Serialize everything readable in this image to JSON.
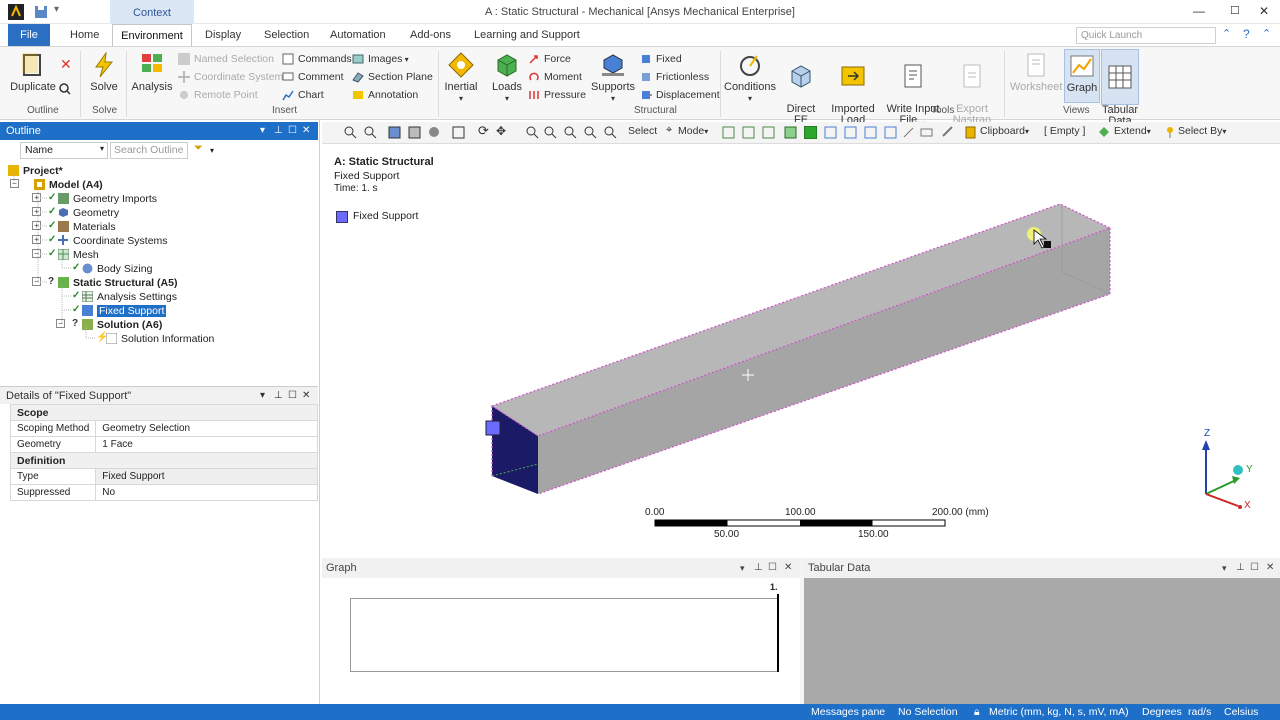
{
  "titlebar": {
    "context_tab": "Context",
    "title": "A : Static Structural - Mechanical [Ansys Mechanical Enterprise]"
  },
  "tabs": {
    "file": "File",
    "home": "Home",
    "environment": "Environment",
    "display": "Display",
    "selection": "Selection",
    "automation": "Automation",
    "addons": "Add-ons",
    "learning": "Learning and Support"
  },
  "quick_launch": {
    "placeholder": "Quick Launch"
  },
  "ribbon": {
    "duplicate": "Duplicate",
    "solve": "Solve",
    "analysis": "Analysis",
    "group_outline": "Outline",
    "group_solve": "Solve",
    "named_selection": "Named Selection",
    "coordinate_system": "Coordinate System",
    "remote_point": "Remote Point",
    "commands": "Commands",
    "comment": "Comment",
    "chart": "Chart",
    "images": "Images",
    "section_plane": "Section Plane",
    "annotation": "Annotation",
    "group_insert": "Insert",
    "inertial": "Inertial",
    "loads": "Loads",
    "force": "Force",
    "moment": "Moment",
    "pressure": "Pressure",
    "supports": "Supports",
    "fixed": "Fixed",
    "frictionless": "Frictionless",
    "displacement": "Displacement",
    "group_structural": "Structural",
    "conditions": "Conditions",
    "direct_fe": "Direct\nFE",
    "imported_load": "Imported\nLoad",
    "write_input": "Write Input\nFile...",
    "export_nastran": "Export\nNastran File",
    "group_tools": "Tools",
    "worksheet": "Worksheet",
    "graph": "Graph",
    "tabular_data": "Tabular\nData",
    "group_views": "Views"
  },
  "outline": {
    "header": "Outline",
    "filter_field": "Name",
    "search_placeholder": "Search Outline",
    "items": [
      "Project*",
      "Model (A4)",
      "Geometry Imports",
      "Geometry",
      "Materials",
      "Coordinate Systems",
      "Mesh",
      "Body Sizing",
      "Static Structural (A5)",
      "Analysis Settings",
      "Fixed Support",
      "Solution (A6)",
      "Solution Information"
    ]
  },
  "details": {
    "header": "Details of \"Fixed Support\"",
    "scope": "Scope",
    "scoping_method_label": "Scoping Method",
    "scoping_method_value": "Geometry Selection",
    "geometry_label": "Geometry",
    "geometry_value": "1 Face",
    "definition": "Definition",
    "type_label": "Type",
    "type_value": "Fixed Support",
    "suppressed_label": "Suppressed",
    "suppressed_value": "No"
  },
  "viewport_toolbar": {
    "select": "Select",
    "mode": "Mode",
    "clipboard": "Clipboard",
    "empty": "[ Empty ]",
    "extend": "Extend",
    "select_by": "Select By"
  },
  "viewport": {
    "title": "A: Static Structural",
    "subtitle": "Fixed Support",
    "time": "Time: 1. s",
    "legend": "Fixed Support",
    "legend_color": "#6b6bff",
    "scale_top": [
      "0.00",
      "100.00",
      "200.00 (mm)"
    ],
    "scale_bottom": [
      "50.00",
      "150.00"
    ],
    "triad": {
      "z": "Z",
      "y": "Y",
      "x": "X"
    }
  },
  "graph": {
    "header": "Graph",
    "marker": "1."
  },
  "tabular": {
    "header": "Tabular Data"
  },
  "status": {
    "messages": "Messages pane",
    "selection": "No Selection",
    "units": "Metric (mm, kg, N, s, mV, mA)",
    "degrees": "Degrees",
    "rads": "rad/s",
    "temp": "Celsius"
  }
}
